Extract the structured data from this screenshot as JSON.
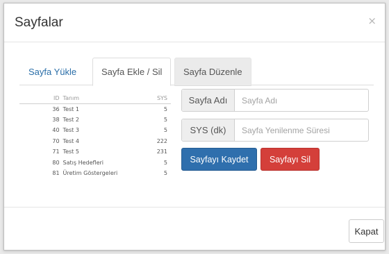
{
  "modal": {
    "title": "Sayfalar",
    "close_icon": "×"
  },
  "tabs": [
    {
      "label": "Sayfa Yükle",
      "active": false
    },
    {
      "label": "Sayfa Ekle / Sil",
      "active": true
    },
    {
      "label": "Sayfa Düzenle",
      "active": false
    }
  ],
  "table": {
    "headers": [
      "ID",
      "Tanım",
      "SYS"
    ],
    "rows": [
      [
        "36",
        "Test 1",
        "5"
      ],
      [
        "38",
        "Test 2",
        "5"
      ],
      [
        "40",
        "Test 3",
        "5"
      ],
      [
        "70",
        "Test 4",
        "222"
      ],
      [
        "71",
        "Test 5",
        "231"
      ],
      [
        "80",
        "Satış Hedefleri",
        "5"
      ],
      [
        "81",
        "Üretim Göstergeleri",
        "5"
      ]
    ]
  },
  "form": {
    "name_label": "Sayfa Adı",
    "name_placeholder": "Sayfa Adı",
    "name_value": "",
    "sys_label": "SYS (dk)",
    "sys_placeholder": "Sayfa Yenilenme Süresi",
    "sys_value": ""
  },
  "buttons": {
    "save": "Sayfayı Kaydet",
    "delete": "Sayfayı Sil",
    "close": "Kapat"
  },
  "colors": {
    "save_button": "#2f6fad",
    "delete_button": "#d43f3a",
    "active_tab_link": "#2a6ea8"
  }
}
